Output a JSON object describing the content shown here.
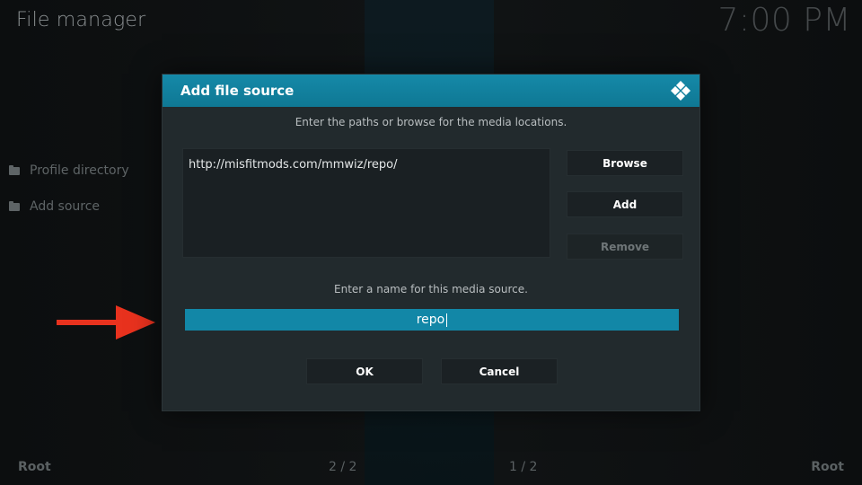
{
  "app": {
    "title": "File manager",
    "clock": "7:00 PM"
  },
  "sidebar": {
    "items": [
      {
        "label": "Profile directory"
      },
      {
        "label": "Add source"
      }
    ]
  },
  "footer": {
    "left": "Root",
    "center_left": "2 / 2",
    "center_right": "1 / 2",
    "right": "Root"
  },
  "dialog": {
    "title": "Add file source",
    "paths_hint": "Enter the paths or browse for the media locations.",
    "paths": [
      "http://misfitmods.com/mmwiz/repo/"
    ],
    "buttons": {
      "browse": "Browse",
      "add": "Add",
      "remove": "Remove",
      "ok": "OK",
      "cancel": "Cancel"
    },
    "name_hint": "Enter a name for this media source.",
    "name_value": "repo"
  },
  "icons": {
    "folder": "folder-icon",
    "kodi_logo": "kodi-logo-icon",
    "annotation_arrow": "red-arrow-icon"
  },
  "colors": {
    "accent": "#1287a7",
    "arrow": "#e8321e"
  }
}
